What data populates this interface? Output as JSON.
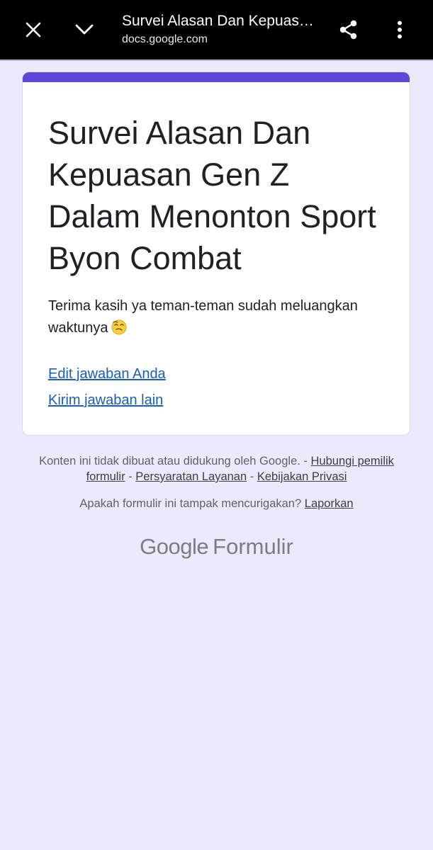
{
  "browser": {
    "title": "Survei Alasan Dan Kepuasan Gen Z Dalam Menonton Sport Byon Combat",
    "url": "docs.google.com"
  },
  "colors": {
    "accent": "#5b48d9",
    "background": "#ebe9fb",
    "link": "#1a5fb4"
  },
  "icons": [
    "close-icon",
    "chevron-down-icon",
    "share-icon",
    "more-vert-icon",
    "emoji-icon"
  ],
  "form": {
    "title": "Survei Alasan Dan Kepuasan Gen Z Dalam Menonton Sport Byon Combat",
    "confirmation": "Terima kasih ya teman-teman sudah meluangkan waktunya",
    "edit_link": "Edit jawaban Anda",
    "another_link": "Kirim jawaban lain"
  },
  "footer": {
    "disclaimer": "Konten ini tidak dibuat atau didukung oleh Google. -",
    "contact_owner": "Hubungi pemilik formulir",
    "sep1": "-",
    "terms": "Persyaratan Layanan",
    "sep2": "-",
    "privacy": "Kebijakan Privasi",
    "suspicious": "Apakah formulir ini tampak mencurigakan?",
    "report": "Laporkan",
    "brand_google": "Google",
    "brand_product": "Formulir"
  }
}
